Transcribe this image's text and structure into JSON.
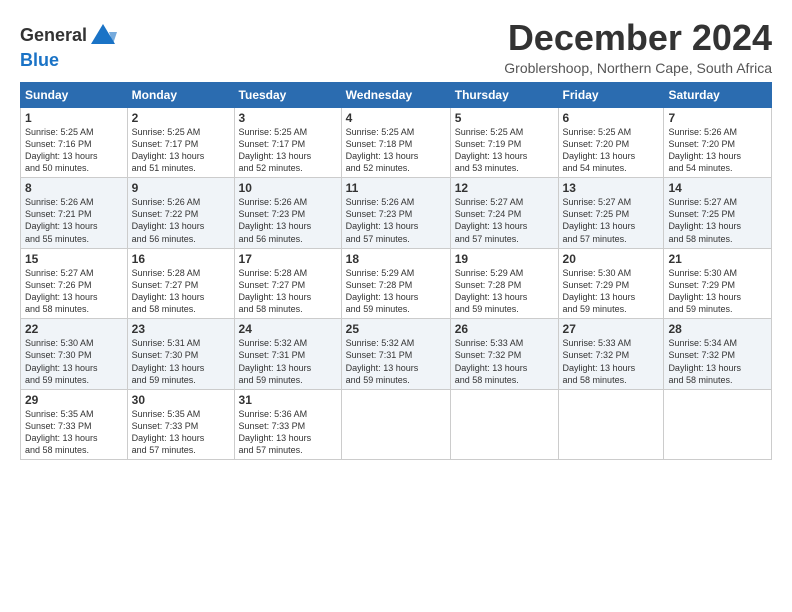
{
  "logo": {
    "line1": "General",
    "line2": "Blue"
  },
  "title": "December 2024",
  "subtitle": "Groblershoop, Northern Cape, South Africa",
  "weekdays": [
    "Sunday",
    "Monday",
    "Tuesday",
    "Wednesday",
    "Thursday",
    "Friday",
    "Saturday"
  ],
  "weeks": [
    [
      {
        "day": "1",
        "info": "Sunrise: 5:25 AM\nSunset: 7:16 PM\nDaylight: 13 hours\nand 50 minutes."
      },
      {
        "day": "2",
        "info": "Sunrise: 5:25 AM\nSunset: 7:17 PM\nDaylight: 13 hours\nand 51 minutes."
      },
      {
        "day": "3",
        "info": "Sunrise: 5:25 AM\nSunset: 7:17 PM\nDaylight: 13 hours\nand 52 minutes."
      },
      {
        "day": "4",
        "info": "Sunrise: 5:25 AM\nSunset: 7:18 PM\nDaylight: 13 hours\nand 52 minutes."
      },
      {
        "day": "5",
        "info": "Sunrise: 5:25 AM\nSunset: 7:19 PM\nDaylight: 13 hours\nand 53 minutes."
      },
      {
        "day": "6",
        "info": "Sunrise: 5:25 AM\nSunset: 7:20 PM\nDaylight: 13 hours\nand 54 minutes."
      },
      {
        "day": "7",
        "info": "Sunrise: 5:26 AM\nSunset: 7:20 PM\nDaylight: 13 hours\nand 54 minutes."
      }
    ],
    [
      {
        "day": "8",
        "info": "Sunrise: 5:26 AM\nSunset: 7:21 PM\nDaylight: 13 hours\nand 55 minutes."
      },
      {
        "day": "9",
        "info": "Sunrise: 5:26 AM\nSunset: 7:22 PM\nDaylight: 13 hours\nand 56 minutes."
      },
      {
        "day": "10",
        "info": "Sunrise: 5:26 AM\nSunset: 7:23 PM\nDaylight: 13 hours\nand 56 minutes."
      },
      {
        "day": "11",
        "info": "Sunrise: 5:26 AM\nSunset: 7:23 PM\nDaylight: 13 hours\nand 57 minutes."
      },
      {
        "day": "12",
        "info": "Sunrise: 5:27 AM\nSunset: 7:24 PM\nDaylight: 13 hours\nand 57 minutes."
      },
      {
        "day": "13",
        "info": "Sunrise: 5:27 AM\nSunset: 7:25 PM\nDaylight: 13 hours\nand 57 minutes."
      },
      {
        "day": "14",
        "info": "Sunrise: 5:27 AM\nSunset: 7:25 PM\nDaylight: 13 hours\nand 58 minutes."
      }
    ],
    [
      {
        "day": "15",
        "info": "Sunrise: 5:27 AM\nSunset: 7:26 PM\nDaylight: 13 hours\nand 58 minutes."
      },
      {
        "day": "16",
        "info": "Sunrise: 5:28 AM\nSunset: 7:27 PM\nDaylight: 13 hours\nand 58 minutes."
      },
      {
        "day": "17",
        "info": "Sunrise: 5:28 AM\nSunset: 7:27 PM\nDaylight: 13 hours\nand 58 minutes."
      },
      {
        "day": "18",
        "info": "Sunrise: 5:29 AM\nSunset: 7:28 PM\nDaylight: 13 hours\nand 59 minutes."
      },
      {
        "day": "19",
        "info": "Sunrise: 5:29 AM\nSunset: 7:28 PM\nDaylight: 13 hours\nand 59 minutes."
      },
      {
        "day": "20",
        "info": "Sunrise: 5:30 AM\nSunset: 7:29 PM\nDaylight: 13 hours\nand 59 minutes."
      },
      {
        "day": "21",
        "info": "Sunrise: 5:30 AM\nSunset: 7:29 PM\nDaylight: 13 hours\nand 59 minutes."
      }
    ],
    [
      {
        "day": "22",
        "info": "Sunrise: 5:30 AM\nSunset: 7:30 PM\nDaylight: 13 hours\nand 59 minutes."
      },
      {
        "day": "23",
        "info": "Sunrise: 5:31 AM\nSunset: 7:30 PM\nDaylight: 13 hours\nand 59 minutes."
      },
      {
        "day": "24",
        "info": "Sunrise: 5:32 AM\nSunset: 7:31 PM\nDaylight: 13 hours\nand 59 minutes."
      },
      {
        "day": "25",
        "info": "Sunrise: 5:32 AM\nSunset: 7:31 PM\nDaylight: 13 hours\nand 59 minutes."
      },
      {
        "day": "26",
        "info": "Sunrise: 5:33 AM\nSunset: 7:32 PM\nDaylight: 13 hours\nand 58 minutes."
      },
      {
        "day": "27",
        "info": "Sunrise: 5:33 AM\nSunset: 7:32 PM\nDaylight: 13 hours\nand 58 minutes."
      },
      {
        "day": "28",
        "info": "Sunrise: 5:34 AM\nSunset: 7:32 PM\nDaylight: 13 hours\nand 58 minutes."
      }
    ],
    [
      {
        "day": "29",
        "info": "Sunrise: 5:35 AM\nSunset: 7:33 PM\nDaylight: 13 hours\nand 58 minutes."
      },
      {
        "day": "30",
        "info": "Sunrise: 5:35 AM\nSunset: 7:33 PM\nDaylight: 13 hours\nand 57 minutes."
      },
      {
        "day": "31",
        "info": "Sunrise: 5:36 AM\nSunset: 7:33 PM\nDaylight: 13 hours\nand 57 minutes."
      },
      {
        "day": "",
        "info": ""
      },
      {
        "day": "",
        "info": ""
      },
      {
        "day": "",
        "info": ""
      },
      {
        "day": "",
        "info": ""
      }
    ]
  ]
}
